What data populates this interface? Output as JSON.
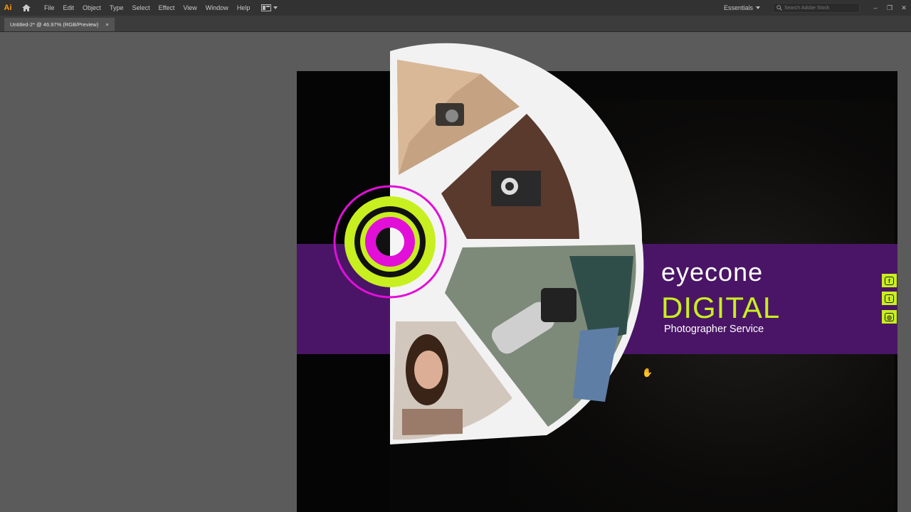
{
  "app": {
    "logo": "Ai"
  },
  "menu": [
    "File",
    "Edit",
    "Object",
    "Type",
    "Select",
    "Effect",
    "View",
    "Window",
    "Help"
  ],
  "workspace": {
    "label": "Essentials"
  },
  "search": {
    "placeholder": "Search Adobe Stock"
  },
  "document_tab": {
    "title": "Untitled-2* @ 46.97% (RGB/Preview)",
    "close": "×"
  },
  "artboard": {
    "brand_name": "eyecone",
    "brand_highlight": "DIGITAL",
    "tagline": "Photographer Service",
    "social": [
      "f",
      "t",
      "◎"
    ]
  },
  "colors": {
    "accent_green": "#c8ef1f",
    "accent_magenta": "#e20fd8",
    "band_purple": "#4a1566"
  },
  "icons": [
    "home-icon",
    "workspace-switcher-icon",
    "search-icon",
    "minimize-icon",
    "maximize-icon",
    "close-icon",
    "hand-cursor-icon"
  ]
}
